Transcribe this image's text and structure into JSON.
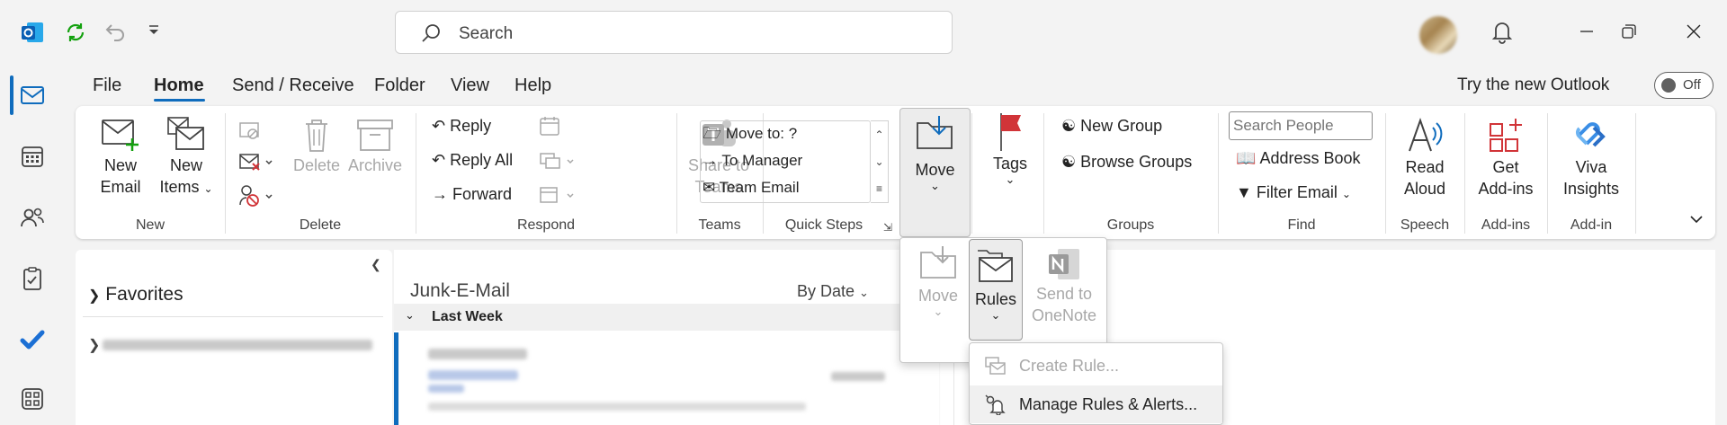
{
  "search": {
    "placeholder": "Search"
  },
  "menu": {
    "tabs": [
      "File",
      "Home",
      "Send / Receive",
      "Folder",
      "View",
      "Help"
    ],
    "active": "Home"
  },
  "try_new": {
    "label": "Try the new Outlook",
    "toggle_state": "Off"
  },
  "ribbon": {
    "new": {
      "new_email": [
        "New",
        "Email"
      ],
      "new_items": [
        "New",
        "Items"
      ],
      "group": "New"
    },
    "delete": {
      "delete": "Delete",
      "archive": "Archive",
      "group": "Delete"
    },
    "respond": {
      "reply": "Reply",
      "reply_all": "Reply All",
      "forward": "Forward",
      "group": "Respond"
    },
    "teams": {
      "share": [
        "Share to",
        "Teams"
      ],
      "group": "Teams"
    },
    "quick_steps": {
      "items": [
        "Move to: ?",
        "To Manager",
        "Team Email"
      ],
      "group": "Quick Steps"
    },
    "move": {
      "label": "Move"
    },
    "tags": {
      "label": "Tags"
    },
    "groups": {
      "new_group": "New Group",
      "browse_groups": "Browse Groups",
      "group": "Groups"
    },
    "find": {
      "search_people_placeholder": "Search People",
      "address_book": "Address Book",
      "filter_email": "Filter Email",
      "group": "Find"
    },
    "speech": {
      "read_aloud": [
        "Read",
        "Aloud"
      ],
      "group": "Speech"
    },
    "addins": {
      "get_addins": [
        "Get",
        "Add-ins"
      ],
      "group": "Add-ins"
    },
    "viva": {
      "label": [
        "Viva",
        "Insights"
      ],
      "group": "Add-in"
    }
  },
  "move_dropdown": {
    "move": "Move",
    "rules": "Rules",
    "send_onenote": [
      "Send to",
      "OneNote"
    ]
  },
  "rules_menu": {
    "items": [
      "Create Rule...",
      "Manage Rules & Alerts..."
    ]
  },
  "nav": {
    "favorites": "Favorites"
  },
  "list": {
    "folder": "Junk-E-Mail",
    "sort": "By Date",
    "group_header": "Last Week"
  },
  "colors": {
    "accent": "#0f6cbd",
    "red": "#d13438"
  }
}
